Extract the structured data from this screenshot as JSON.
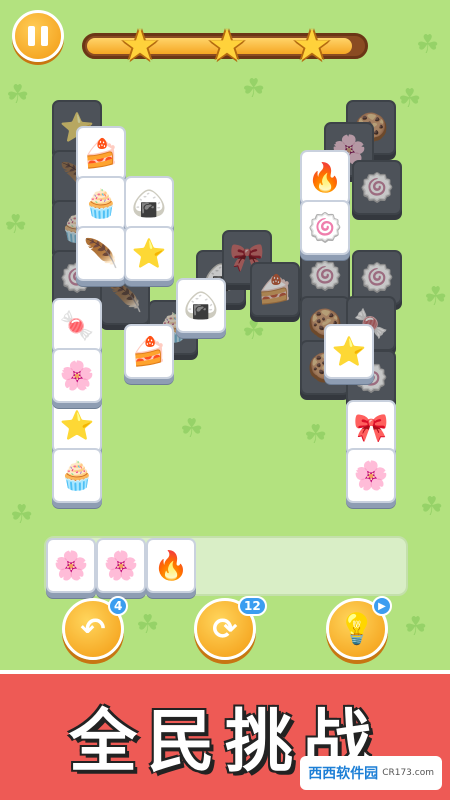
{
  "header": {
    "stars_count": 3,
    "progress_fraction": 0.96
  },
  "board": {
    "tiles": [
      {
        "icon": "🍰",
        "name": "cupcake-tile",
        "dark": false
      },
      {
        "icon": "🧁",
        "name": "muffin-tile",
        "dark": false
      },
      {
        "icon": "🍙",
        "name": "rice-dumpling-tile",
        "dark": false
      },
      {
        "icon": "🔥",
        "name": "campfire-tile",
        "dark": false
      },
      {
        "icon": "🪶",
        "name": "feather-tile",
        "dark": false
      },
      {
        "icon": "⭐",
        "name": "star-cookie-tile",
        "dark": false
      },
      {
        "icon": "🍥",
        "name": "swiss-roll-tile",
        "dark": false
      },
      {
        "icon": "🍙",
        "name": "rice-dumpling-tile",
        "dark": false
      },
      {
        "icon": "🍬",
        "name": "candy-tile",
        "dark": false
      },
      {
        "icon": "🍰",
        "name": "cupcake-tile",
        "dark": false
      },
      {
        "icon": "⭐",
        "name": "star-cookie-tile",
        "dark": false
      },
      {
        "icon": "🌸",
        "name": "flower-tile",
        "dark": false
      },
      {
        "icon": "⭐",
        "name": "star-cookie-tile",
        "dark": false
      },
      {
        "icon": "🎀",
        "name": "bow-tile",
        "dark": false
      },
      {
        "icon": "🧁",
        "name": "muffin-tile",
        "dark": false
      },
      {
        "icon": "🌸",
        "name": "flower-tile",
        "dark": false
      }
    ]
  },
  "tray": {
    "slots": [
      {
        "icon": "🌸",
        "name": "flower-tile"
      },
      {
        "icon": "🌸",
        "name": "flower-tile"
      },
      {
        "icon": "🔥",
        "name": "campfire-tile"
      }
    ]
  },
  "powerups": {
    "undo_count": "4",
    "shuffle_count": "12"
  },
  "banner": {
    "title": "全民挑战"
  },
  "watermark": {
    "brand": "西西软件园",
    "site": "CR173.com"
  },
  "colors": {
    "background": "#b3e27f",
    "banner": "#ee5a55",
    "accent": "#f39a12"
  }
}
